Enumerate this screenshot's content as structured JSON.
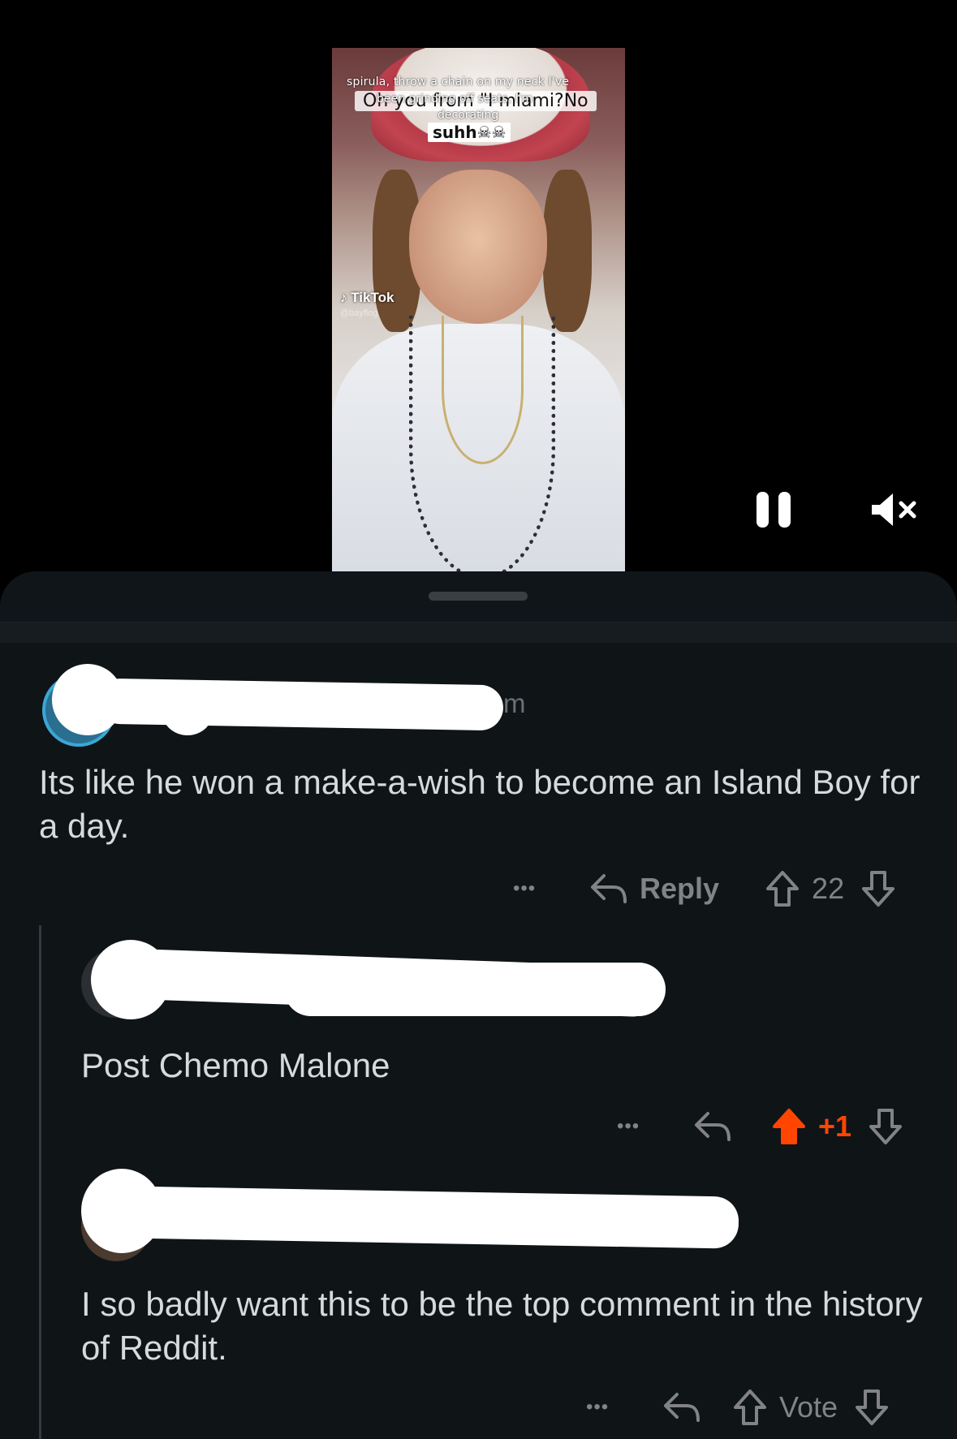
{
  "video": {
    "caption_line1": "spirula, throw a chain on my neck I've",
    "caption_line2": "been grinding off seats, I'm",
    "caption_line3": "decorating",
    "caption_box": "Oh you from \"I miami?No",
    "caption_box2": "suhh☠☠",
    "watermark": "TikTok",
    "handle": "@bayflog",
    "pause_icon": "pause-icon",
    "mute_icon": "speaker-muted-icon"
  },
  "comments": [
    {
      "meta_visible_tail": "m",
      "body": "Its like he won a make-a-wish to become an Island Boy for a day.",
      "actions": {
        "more": "•••",
        "reply_label": "Reply",
        "score": "22"
      }
    },
    {
      "body": "Post Chemo Malone",
      "actions": {
        "more": "•••",
        "score": "+1",
        "upvoted": true
      }
    },
    {
      "body": "I so badly want this to be the top comment in the history of Reddit.",
      "actions": {
        "more": "•••",
        "score": "Vote"
      }
    }
  ],
  "colors": {
    "background": "#0f1417",
    "text": "#d7dadc",
    "muted": "#818384",
    "upvote": "#ff4500"
  }
}
